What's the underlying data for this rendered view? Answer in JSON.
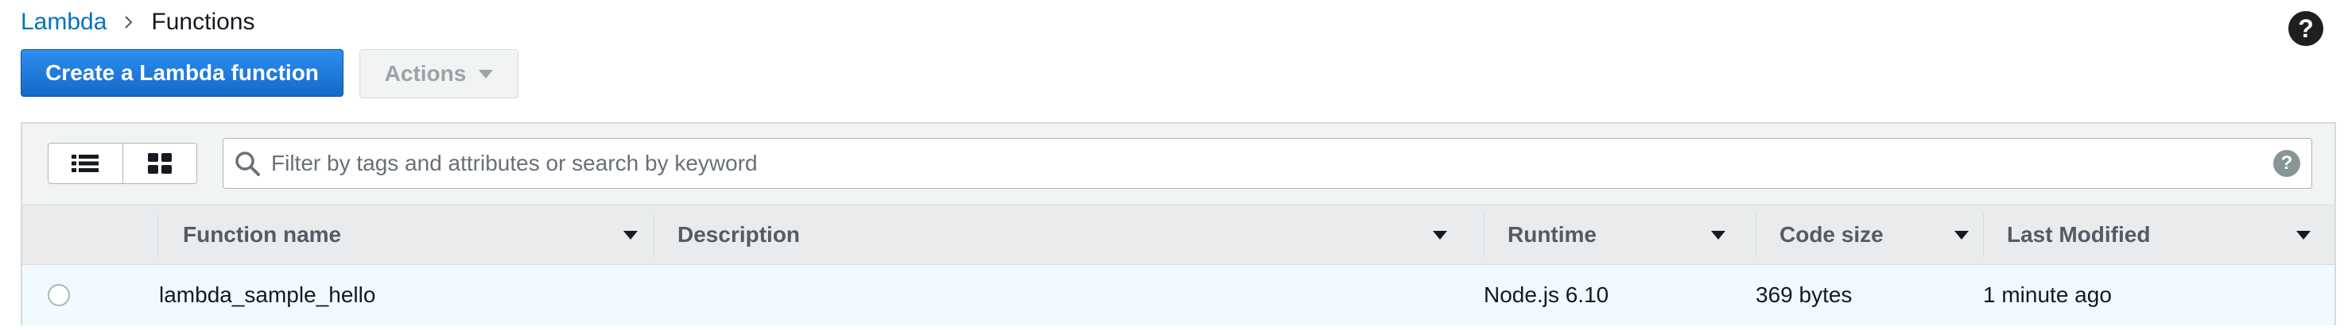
{
  "breadcrumb": {
    "parent": "Lambda",
    "current": "Functions"
  },
  "header": {
    "help_symbol": "?"
  },
  "toolbar": {
    "create_label": "Create a Lambda function",
    "actions_label": "Actions"
  },
  "search": {
    "placeholder": "Filter by tags and attributes or search by keyword",
    "help_symbol": "?"
  },
  "table": {
    "columns": [
      "Function name",
      "Description",
      "Runtime",
      "Code size",
      "Last Modified"
    ],
    "rows": [
      {
        "name": "lambda_sample_hello",
        "description": "",
        "runtime": "Node.js 6.10",
        "code_size": "369 bytes",
        "last_modified": "1 minute ago",
        "selected": false
      }
    ]
  },
  "colors": {
    "link": "#0073bb",
    "primary_button": "#1a73d3",
    "row_highlight": "#f1faff",
    "header_bg": "#e9ebed"
  }
}
